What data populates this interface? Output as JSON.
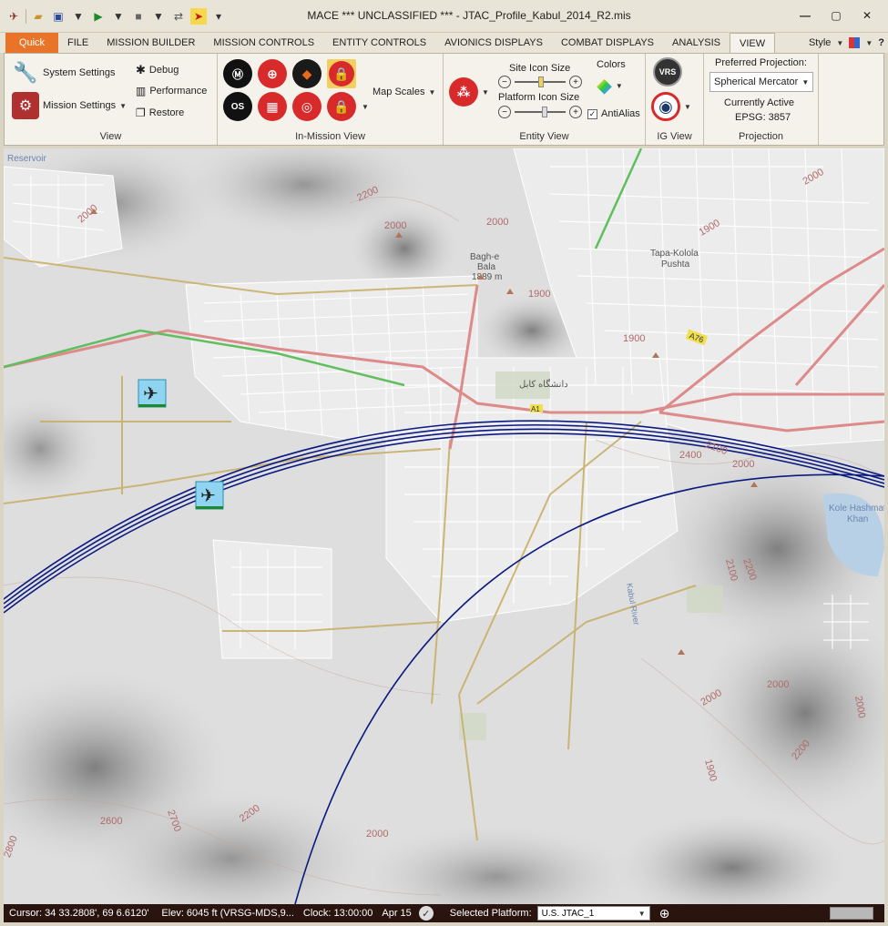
{
  "window": {
    "title": "MACE  *** UNCLASSIFIED ***  - JTAC_Profile_Kabul_2014_R2.mis"
  },
  "quick_access": {
    "icons": [
      "app-icon",
      "open-folder-icon",
      "save-icon",
      "play-icon",
      "stop-icon",
      "pointer-icon"
    ]
  },
  "tabs": [
    {
      "label": "Quick"
    },
    {
      "label": "FILE"
    },
    {
      "label": "MISSION BUILDER"
    },
    {
      "label": "MISSION CONTROLS"
    },
    {
      "label": "ENTITY  CONTROLS"
    },
    {
      "label": "AVIONICS DISPLAYS"
    },
    {
      "label": "COMBAT DISPLAYS"
    },
    {
      "label": "ANALYSIS"
    },
    {
      "label": "VIEW"
    }
  ],
  "style_menu": {
    "label": "Style"
  },
  "ribbon": {
    "view_group": {
      "label": "View",
      "system_settings": "System Settings",
      "mission_settings": "Mission Settings",
      "debug": "Debug",
      "performance": "Performance",
      "restore": "Restore"
    },
    "in_mission_view": {
      "label": "In-Mission View",
      "map_scales": "Map Scales"
    },
    "entity_view": {
      "label": "Entity View",
      "site_icon_size": "Site Icon Size",
      "platform_icon_size": "Platform Icon Size",
      "site_icon_level": 0.55,
      "platform_icon_level": 0.6,
      "colors": "Colors",
      "antialias": "AntiAlias",
      "antialias_checked": true
    },
    "ig_view": {
      "label": "IG View"
    },
    "projection": {
      "label": "Projection",
      "preferred": "Preferred Projection:",
      "selected": "Spherical Mercator",
      "currently_active": "Currently Active",
      "epsg": "EPSG: 3857"
    }
  },
  "map": {
    "labels": {
      "reservoir": "Reservoir",
      "bagh": "Bagh-e",
      "bala": "Bala",
      "bala_elev": "1889 m",
      "tapa": "Tapa-Kolola",
      "pushta": "Pushta",
      "kabul_uni": "دانشگاه کابل",
      "kabul_river": "Kabul River",
      "kole": "Kole Hashmat",
      "khan": "Khan",
      "road": "A76",
      "road_a1": "A1"
    },
    "contours": [
      "2200",
      "2000",
      "2000",
      "2000",
      "1900",
      "1900",
      "1900",
      "2100",
      "2400",
      "2000",
      "2200",
      "2100",
      "2000",
      "2000",
      "1900",
      "2200",
      "2000",
      "2600",
      "2700",
      "2200",
      "2800",
      "2000",
      "2000"
    ]
  },
  "statusbar": {
    "cursor": "Cursor: 34 33.2808', 69 6.6120'",
    "elev": "Elev:  6045 ft (VRSG-MDS,9...",
    "clock": "Clock:  13:00:00",
    "date": "Apr 15",
    "selected_platform_label": "Selected Platform:",
    "selected_platform": "U.S. JTAC_1"
  },
  "colors": {
    "quick_tab": "#e8742a",
    "arc": "#0a1a80",
    "statusbar": "#2a1410"
  }
}
